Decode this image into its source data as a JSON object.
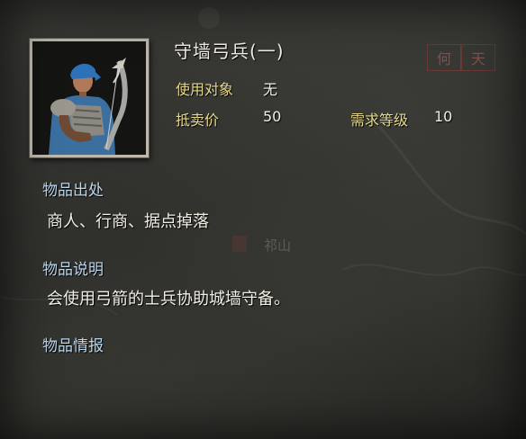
{
  "item": {
    "name": "守墙弓兵(一)",
    "target_label": "使用对象",
    "target_value": "无",
    "price_label": "抵卖价",
    "price_value": "50",
    "level_label": "需求等级",
    "level_value": "10"
  },
  "sections": {
    "source_title": "物品出处",
    "source_text": "商人、行商、据点掉落",
    "desc_title": "物品说明",
    "desc_text": "会使用弓箭的士兵协助城墙守备。",
    "info_title": "物品情报"
  },
  "map_marks": {
    "stamp1": "何",
    "stamp2": "天",
    "place": "祁山"
  },
  "icons": [
    "soldier-portrait-icon"
  ],
  "colors": {
    "label_gold": "#e8d98a",
    "section_blue": "#bcd6ec",
    "text_white": "#f1eee4",
    "frame": "#bdb8ab"
  }
}
